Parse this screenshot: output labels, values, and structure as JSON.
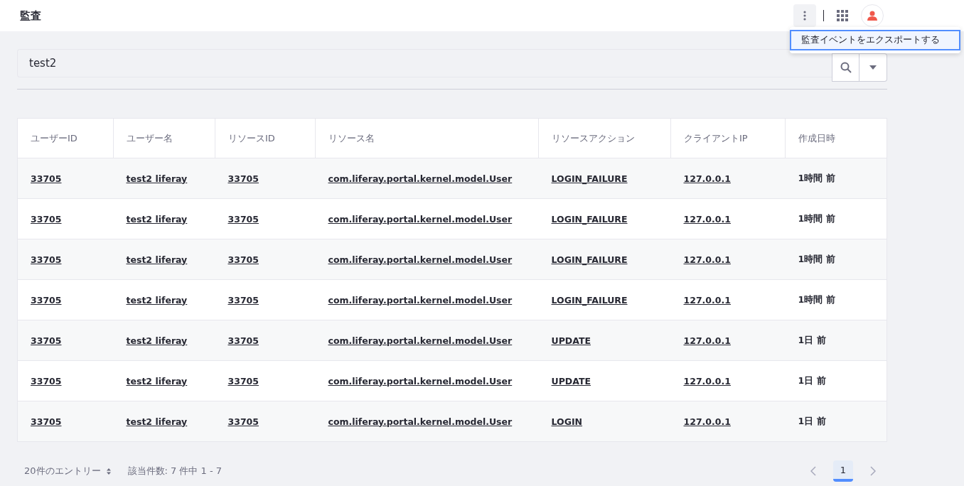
{
  "header": {
    "title": "監査"
  },
  "menu": {
    "items": [
      {
        "label": "監査イベントをエクスポートする",
        "selected": true
      }
    ]
  },
  "search": {
    "value": "test2"
  },
  "table": {
    "columns": [
      "ユーザーID",
      "ユーザー名",
      "リソースID",
      "リソース名",
      "リソースアクション",
      "クライアントIP",
      "作成日時"
    ],
    "rows": [
      [
        "33705",
        "test2 liferay",
        "33705",
        "com.liferay.portal.kernel.model.User",
        "LOGIN_FAILURE",
        "127.0.0.1",
        "1時間 前"
      ],
      [
        "33705",
        "test2 liferay",
        "33705",
        "com.liferay.portal.kernel.model.User",
        "LOGIN_FAILURE",
        "127.0.0.1",
        "1時間 前"
      ],
      [
        "33705",
        "test2 liferay",
        "33705",
        "com.liferay.portal.kernel.model.User",
        "LOGIN_FAILURE",
        "127.0.0.1",
        "1時間 前"
      ],
      [
        "33705",
        "test2 liferay",
        "33705",
        "com.liferay.portal.kernel.model.User",
        "LOGIN_FAILURE",
        "127.0.0.1",
        "1時間 前"
      ],
      [
        "33705",
        "test2 liferay",
        "33705",
        "com.liferay.portal.kernel.model.User",
        "UPDATE",
        "127.0.0.1",
        "1日 前"
      ],
      [
        "33705",
        "test2 liferay",
        "33705",
        "com.liferay.portal.kernel.model.User",
        "UPDATE",
        "127.0.0.1",
        "1日 前"
      ],
      [
        "33705",
        "test2 liferay",
        "33705",
        "com.liferay.portal.kernel.model.User",
        "LOGIN",
        "127.0.0.1",
        "1日 前"
      ]
    ]
  },
  "pagination": {
    "page_size": "20件のエントリー",
    "summary": "該当件数: 7 件中 1 - 7",
    "pages": [
      {
        "label": "1",
        "selected": true
      }
    ]
  }
}
